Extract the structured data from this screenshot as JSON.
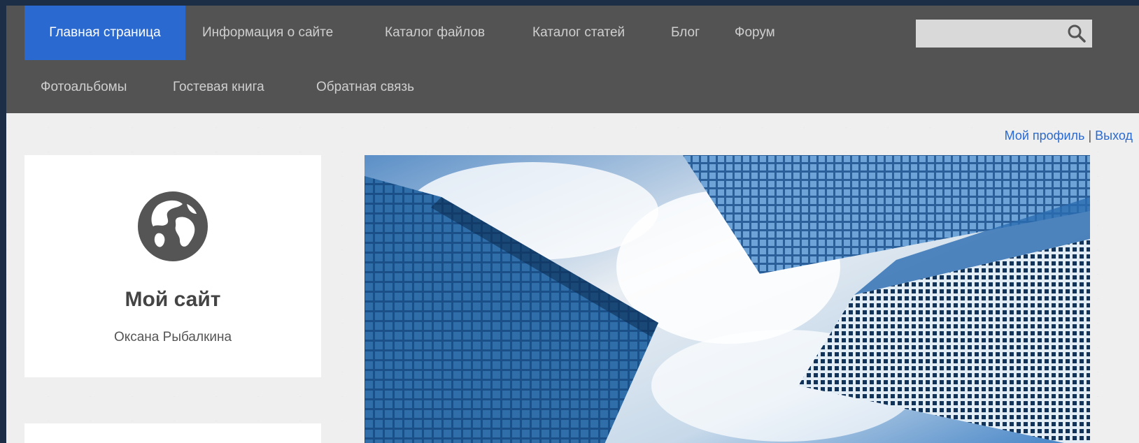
{
  "nav": {
    "items": [
      {
        "label": "Главная страница",
        "active": true
      },
      {
        "label": "Информация о сайте"
      },
      {
        "label": "Каталог файлов"
      },
      {
        "label": "Каталог статей"
      },
      {
        "label": "Блог"
      },
      {
        "label": "Форум"
      },
      {
        "label": "Фотоальбомы"
      },
      {
        "label": "Гостевая книга"
      },
      {
        "label": "Обратная связь"
      }
    ]
  },
  "search": {
    "placeholder": "",
    "value": "",
    "icon": "search-icon"
  },
  "user": {
    "profile_label": "Мой профиль",
    "separator": "|",
    "logout_label": "Выход"
  },
  "site": {
    "title": "Мой сайт",
    "owner": "Оксана Рыбалкина",
    "logo_icon": "globe-icon"
  },
  "hero": {
    "image": "skyscrapers-photo"
  },
  "colors": {
    "accent": "#2a6ad0",
    "nav_bg": "#535353",
    "page_bg": "#efefef"
  }
}
